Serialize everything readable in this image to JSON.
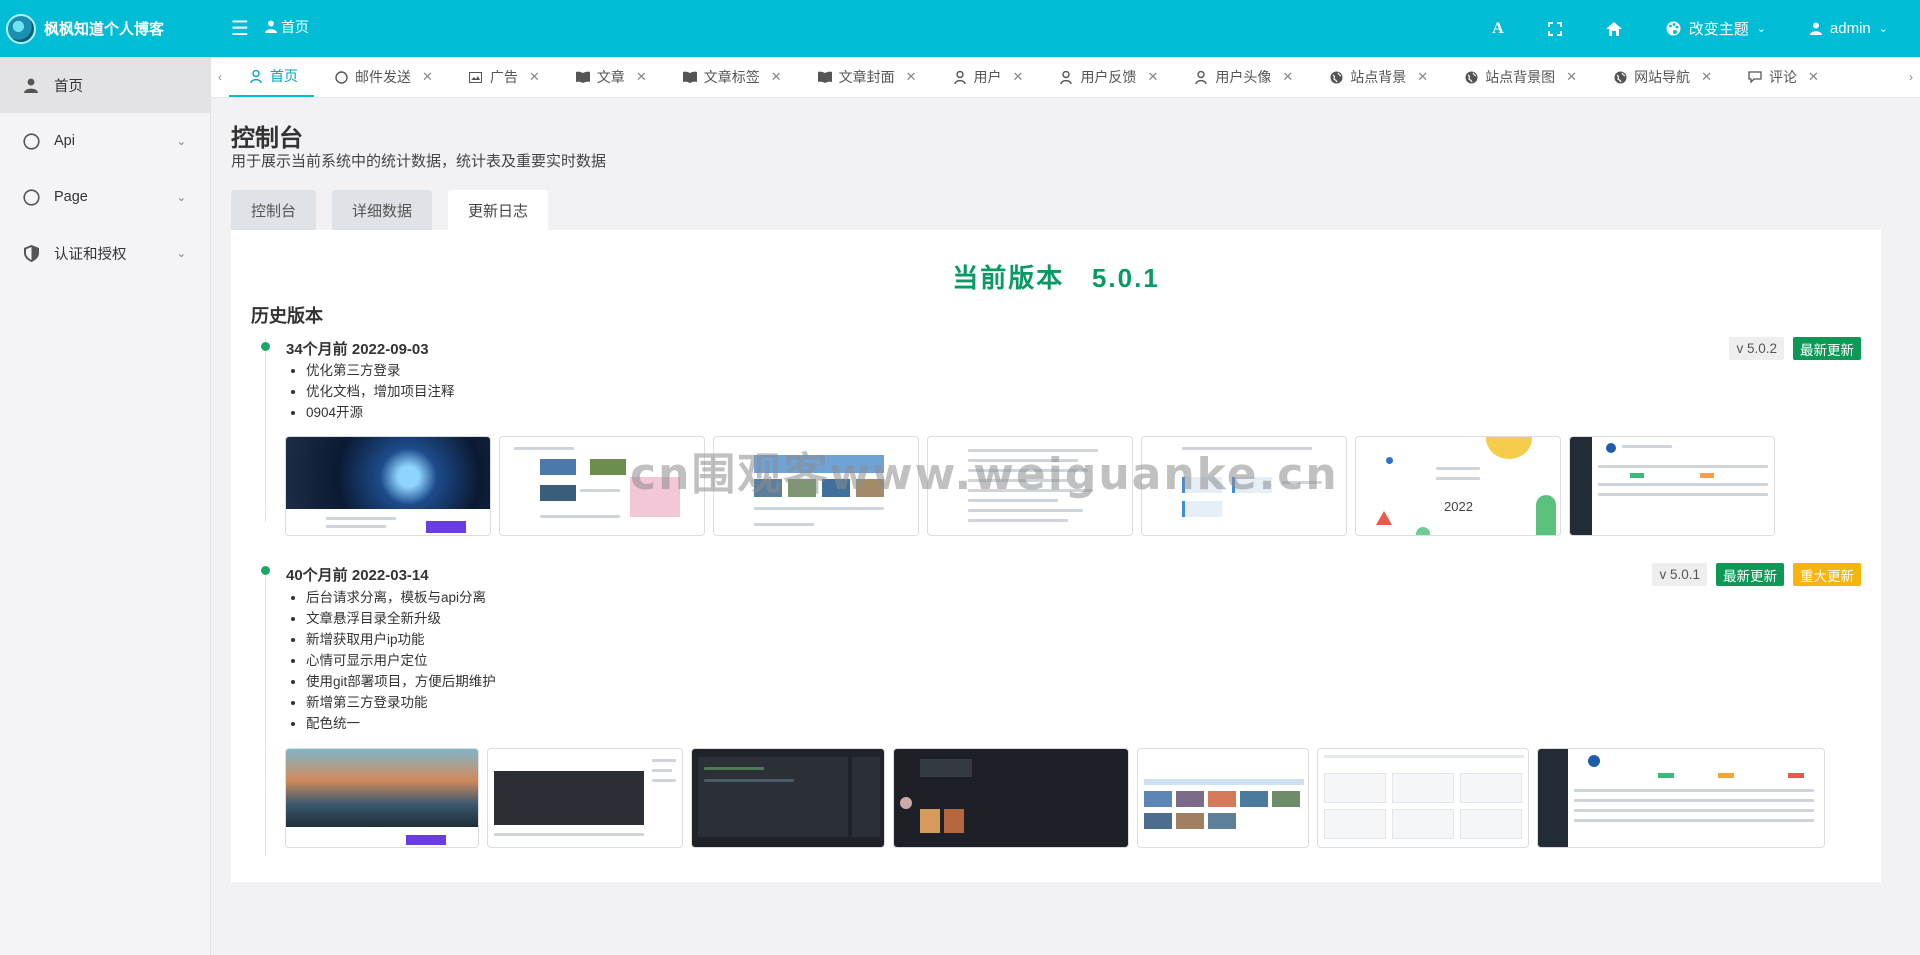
{
  "header": {
    "brand": "枫枫知道个人博客",
    "crumb": "首页",
    "font_label": "A",
    "theme_label": "改变主题",
    "user_label": "admin"
  },
  "sidebar": {
    "items": [
      {
        "label": "首页",
        "icon": "user-icon"
      },
      {
        "label": "Api",
        "icon": "circle-icon"
      },
      {
        "label": "Page",
        "icon": "circle-icon"
      },
      {
        "label": "认证和授权",
        "icon": "shield-icon"
      }
    ]
  },
  "tabs": [
    {
      "label": "首页",
      "icon": "user-icon",
      "closable": false
    },
    {
      "label": "邮件发送",
      "icon": "circle-icon",
      "closable": true
    },
    {
      "label": "广告",
      "icon": "image-icon",
      "closable": true
    },
    {
      "label": "文章",
      "icon": "book-icon",
      "closable": true
    },
    {
      "label": "文章标签",
      "icon": "book-icon",
      "closable": true
    },
    {
      "label": "文章封面",
      "icon": "book-icon",
      "closable": true
    },
    {
      "label": "用户",
      "icon": "user-icon",
      "closable": true
    },
    {
      "label": "用户反馈",
      "icon": "user-icon",
      "closable": true
    },
    {
      "label": "用户头像",
      "icon": "user-icon",
      "closable": true
    },
    {
      "label": "站点背景",
      "icon": "globe-icon",
      "closable": true
    },
    {
      "label": "站点背景图",
      "icon": "globe-icon",
      "closable": true
    },
    {
      "label": "网站导航",
      "icon": "globe-icon",
      "closable": true
    },
    {
      "label": "评论",
      "icon": "comment-icon",
      "closable": true
    }
  ],
  "page": {
    "title": "控制台",
    "subtitle": "用于展示当前系统中的统计数据，统计表及重要实时数据",
    "subtabs": [
      "控制台",
      "详细数据",
      "更新日志"
    ]
  },
  "changelog": {
    "current_label": "当前版本",
    "current_version": "5.0.1",
    "history_title": "历史版本",
    "entries": [
      {
        "ago": "34个月前",
        "date": "2022-09-03",
        "version": "v 5.0.2",
        "tags": [
          "最新更新"
        ],
        "items": [
          "优化第三方登录",
          "优化文档，增加项目注释",
          "0904开源"
        ]
      },
      {
        "ago": "40个月前",
        "date": "2022-03-14",
        "version": "v 5.0.1",
        "tags": [
          "最新更新",
          "重大更新"
        ],
        "items": [
          "后台请求分离，模板与api分离",
          "文章悬浮目录全新升级",
          "新增获取用户ip功能",
          "心情可显示用户定位",
          "使用git部署项目，方便后期维护",
          "新增第三方登录功能",
          "配色统一"
        ]
      }
    ]
  },
  "colors": {
    "primary": "#00bcd4",
    "success": "#0c9956",
    "warning": "#f6b50e",
    "version_text": "#079a63"
  },
  "watermark": "cn围观客www.weiguanke.cn"
}
